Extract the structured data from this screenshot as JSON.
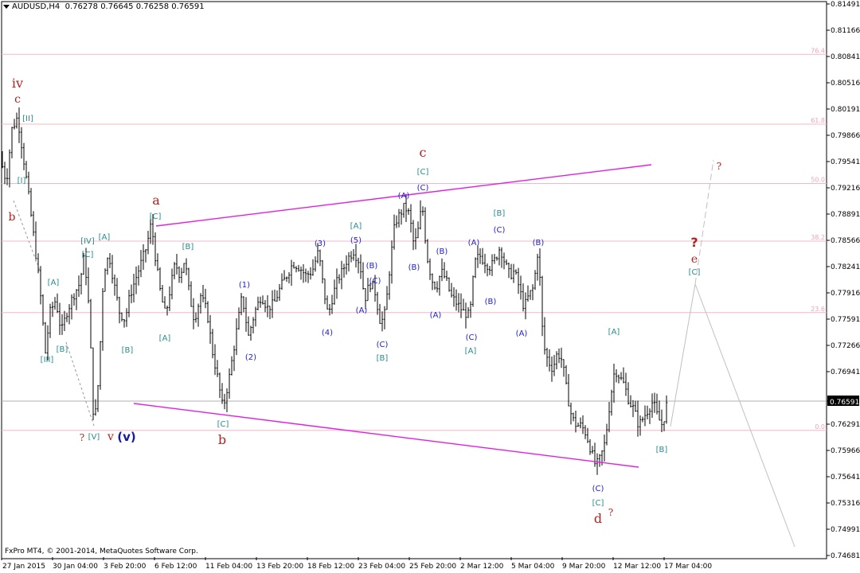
{
  "header": {
    "symbol": "AUDUSD,H4",
    "ohlc": "0.76278 0.76645 0.76258 0.76591"
  },
  "footer": {
    "copyright": "FxPro MT4, © 2001-2014, MetaQuotes Software Corp."
  },
  "colors": {
    "background": "#ffffff",
    "axis": "#000000",
    "candles": "#000000",
    "fib_lines": "#f4b8c6",
    "fib_labels": "#f2a3b5",
    "channel": "#e020e0",
    "projection": "#c0c0c0",
    "bid_line": "#b0b0b0",
    "label_red": "#b22222",
    "label_teal": "#2a8c8c",
    "label_blue": "#2222cc",
    "label_navy": "#1a1aa0"
  },
  "chart_data": {
    "type": "candlestick",
    "timeframe": "H4",
    "ylim": [
      0.74681,
      0.81491
    ],
    "y_ticks": [
      "0.81491",
      "0.81166",
      "0.80841",
      "0.80516",
      "0.80191",
      "0.79866",
      "0.79541",
      "0.79216",
      "0.78891",
      "0.78566",
      "0.78241",
      "0.77916",
      "0.77591",
      "0.77266",
      "0.76941",
      "0.76591",
      "0.76291",
      "0.75966",
      "0.75641",
      "0.75316",
      "0.74991",
      "0.74681"
    ],
    "x_ticks": [
      "27 Jan 2015",
      "30 Jan 04:00",
      "3 Feb 20:00",
      "6 Feb 12:00",
      "11 Feb 04:00",
      "13 Feb 20:00",
      "18 Feb 12:00",
      "23 Feb 04:00",
      "25 Feb 20:00",
      "2 Mar 12:00",
      "5 Mar 04:00",
      "9 Mar 20:00",
      "12 Mar 12:00",
      "17 Mar 04:00"
    ],
    "current_price": "0.76591",
    "fib_levels": [
      {
        "label": "76.4",
        "price": 0.80871
      },
      {
        "label": "61.8",
        "price": 0.80011
      },
      {
        "label": "50.0",
        "price": 0.79281
      },
      {
        "label": "38.2",
        "price": 0.78571
      },
      {
        "label": "23.6",
        "price": 0.77691
      },
      {
        "label": "0.0",
        "price": 0.76241
      }
    ],
    "price_path": [
      [
        0,
        0.796
      ],
      [
        8,
        0.793
      ],
      [
        15,
        0.7995
      ],
      [
        22,
        0.801
      ],
      [
        28,
        0.797
      ],
      [
        35,
        0.792
      ],
      [
        42,
        0.7865
      ],
      [
        50,
        0.78
      ],
      [
        57,
        0.772
      ],
      [
        63,
        0.777
      ],
      [
        70,
        0.7785
      ],
      [
        77,
        0.7745
      ],
      [
        84,
        0.777
      ],
      [
        92,
        0.779
      ],
      [
        100,
        0.7805
      ],
      [
        106,
        0.784
      ],
      [
        112,
        0.777
      ],
      [
        118,
        0.7625
      ],
      [
        124,
        0.769
      ],
      [
        130,
        0.782
      ],
      [
        137,
        0.784
      ],
      [
        144,
        0.78
      ],
      [
        150,
        0.777
      ],
      [
        157,
        0.776
      ],
      [
        163,
        0.779
      ],
      [
        170,
        0.781
      ],
      [
        177,
        0.783
      ],
      [
        184,
        0.785
      ],
      [
        190,
        0.788
      ],
      [
        196,
        0.783
      ],
      [
        202,
        0.779
      ],
      [
        208,
        0.7765
      ],
      [
        214,
        0.78
      ],
      [
        220,
        0.783
      ],
      [
        226,
        0.7815
      ],
      [
        232,
        0.7835
      ],
      [
        238,
        0.779
      ],
      [
        244,
        0.776
      ],
      [
        252,
        0.779
      ],
      [
        260,
        0.777
      ],
      [
        267,
        0.772
      ],
      [
        273,
        0.769
      ],
      [
        280,
        0.765
      ],
      [
        288,
        0.769
      ],
      [
        296,
        0.774
      ],
      [
        304,
        0.779
      ],
      [
        312,
        0.774
      ],
      [
        320,
        0.777
      ],
      [
        328,
        0.779
      ],
      [
        336,
        0.7775
      ],
      [
        344,
        0.778
      ],
      [
        352,
        0.78
      ],
      [
        360,
        0.7815
      ],
      [
        368,
        0.783
      ],
      [
        376,
        0.7825
      ],
      [
        384,
        0.7815
      ],
      [
        392,
        0.782
      ],
      [
        400,
        0.7845
      ],
      [
        406,
        0.78
      ],
      [
        412,
        0.7765
      ],
      [
        418,
        0.779
      ],
      [
        424,
        0.781
      ],
      [
        430,
        0.782
      ],
      [
        436,
        0.7835
      ],
      [
        444,
        0.7845
      ],
      [
        452,
        0.783
      ],
      [
        458,
        0.7785
      ],
      [
        464,
        0.7805
      ],
      [
        470,
        0.78
      ],
      [
        478,
        0.7755
      ],
      [
        484,
        0.777
      ],
      [
        490,
        0.783
      ],
      [
        496,
        0.788
      ],
      [
        502,
        0.789
      ],
      [
        508,
        0.79
      ],
      [
        514,
        0.789
      ],
      [
        520,
        0.785
      ],
      [
        526,
        0.7875
      ],
      [
        530,
        0.7905
      ],
      [
        536,
        0.784
      ],
      [
        542,
        0.781
      ],
      [
        548,
        0.78
      ],
      [
        554,
        0.782
      ],
      [
        560,
        0.781
      ],
      [
        566,
        0.779
      ],
      [
        574,
        0.778
      ],
      [
        582,
        0.777
      ],
      [
        590,
        0.7765
      ],
      [
        596,
        0.783
      ],
      [
        602,
        0.784
      ],
      [
        610,
        0.783
      ],
      [
        616,
        0.7825
      ],
      [
        622,
        0.7835
      ],
      [
        628,
        0.785
      ],
      [
        634,
        0.783
      ],
      [
        640,
        0.7815
      ],
      [
        646,
        0.782
      ],
      [
        652,
        0.78
      ],
      [
        658,
        0.7775
      ],
      [
        664,
        0.779
      ],
      [
        670,
        0.78
      ],
      [
        676,
        0.785
      ],
      [
        682,
        0.773
      ],
      [
        688,
        0.771
      ],
      [
        694,
        0.77
      ],
      [
        700,
        0.772
      ],
      [
        706,
        0.771
      ],
      [
        712,
        0.767
      ],
      [
        718,
        0.764
      ],
      [
        724,
        0.763
      ],
      [
        730,
        0.763
      ],
      [
        736,
        0.762
      ],
      [
        742,
        0.76
      ],
      [
        748,
        0.758
      ],
      [
        754,
        0.759
      ],
      [
        760,
        0.761
      ],
      [
        766,
        0.766
      ],
      [
        772,
        0.77
      ],
      [
        778,
        0.769
      ],
      [
        784,
        0.768
      ],
      [
        790,
        0.766
      ],
      [
        796,
        0.765
      ],
      [
        802,
        0.763
      ],
      [
        808,
        0.764
      ],
      [
        814,
        0.765
      ],
      [
        820,
        0.766
      ],
      [
        826,
        0.764
      ],
      [
        832,
        0.763
      ],
      [
        838,
        0.766
      ]
    ],
    "channels": [
      {
        "name": "upper",
        "from": [
          "6 Feb 12:00",
          0.7875
        ],
        "to": [
          "17 Mar 04:00",
          0.7951
        ]
      },
      {
        "name": "lower",
        "from": [
          "3 Feb 20:00",
          0.766
        ],
        "to": [
          "12 Mar 12:00",
          0.7573
        ]
      }
    ],
    "wave_labels": [
      {
        "text": "iv",
        "color": "red"
      },
      {
        "text": "c",
        "color": "red"
      },
      {
        "text": "[II]",
        "color": "teal"
      },
      {
        "text": "[I]",
        "color": "teal"
      },
      {
        "text": "b",
        "color": "red"
      },
      {
        "text": "[A]",
        "color": "teal"
      },
      {
        "text": "[III]",
        "color": "teal"
      },
      {
        "text": "[B]",
        "color": "teal"
      },
      {
        "text": "[IV]",
        "color": "teal"
      },
      {
        "text": "[C]",
        "color": "teal"
      },
      {
        "text": "[A]",
        "color": "teal"
      },
      {
        "text": "?",
        "color": "red"
      },
      {
        "text": "[V]",
        "color": "teal"
      },
      {
        "text": "v",
        "color": "red"
      },
      {
        "text": "(v)",
        "color": "navy"
      },
      {
        "text": "[B]",
        "color": "teal"
      },
      {
        "text": "a",
        "color": "red"
      },
      {
        "text": "[C]",
        "color": "teal"
      },
      {
        "text": "[B]",
        "color": "teal"
      },
      {
        "text": "[A]",
        "color": "teal"
      },
      {
        "text": "[C]",
        "color": "teal"
      },
      {
        "text": "b",
        "color": "red"
      },
      {
        "text": "(1)",
        "color": "blue"
      },
      {
        "text": "(2)",
        "color": "blue"
      },
      {
        "text": "(3)",
        "color": "blue"
      },
      {
        "text": "(4)",
        "color": "blue"
      },
      {
        "text": "[A]",
        "color": "teal"
      },
      {
        "text": "(5)",
        "color": "blue"
      },
      {
        "text": "(B)",
        "color": "blue"
      },
      {
        "text": "(C)",
        "color": "blue"
      },
      {
        "text": "(A)",
        "color": "blue"
      },
      {
        "text": "(C)",
        "color": "blue"
      },
      {
        "text": "[B]",
        "color": "teal"
      },
      {
        "text": "c",
        "color": "red"
      },
      {
        "text": "[C]",
        "color": "teal"
      },
      {
        "text": "(A)",
        "color": "blue"
      },
      {
        "text": "(C)",
        "color": "blue"
      },
      {
        "text": "(B)",
        "color": "blue"
      },
      {
        "text": "(B)",
        "color": "blue"
      },
      {
        "text": "(A)",
        "color": "blue"
      },
      {
        "text": "(A)",
        "color": "blue"
      },
      {
        "text": "(C)",
        "color": "blue"
      },
      {
        "text": "[A]",
        "color": "teal"
      },
      {
        "text": "[B]",
        "color": "teal"
      },
      {
        "text": "(C)",
        "color": "blue"
      },
      {
        "text": "(B)",
        "color": "blue"
      },
      {
        "text": "(B)",
        "color": "blue"
      },
      {
        "text": "(A)",
        "color": "blue"
      },
      {
        "text": "[A]",
        "color": "teal"
      },
      {
        "text": "(C)",
        "color": "blue"
      },
      {
        "text": "[C]",
        "color": "teal"
      },
      {
        "text": "d",
        "color": "red"
      },
      {
        "text": "?",
        "color": "red"
      },
      {
        "text": "[B]",
        "color": "teal"
      },
      {
        "text": "?",
        "color": "red"
      },
      {
        "text": "e",
        "color": "red"
      },
      {
        "text": "[C]",
        "color": "teal"
      },
      {
        "text": "?",
        "color": "red"
      }
    ]
  }
}
